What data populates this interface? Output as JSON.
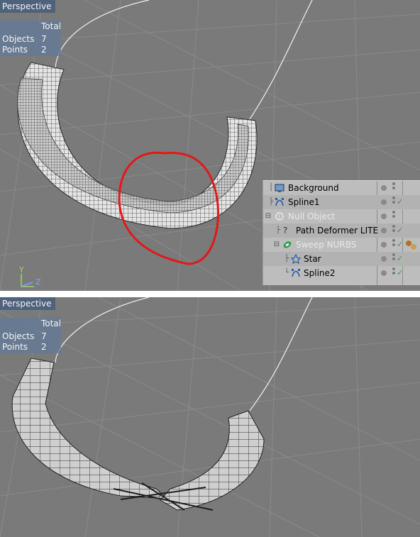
{
  "viewport_top": {
    "title": "Perspective",
    "hud": {
      "header": "Total",
      "rows": [
        {
          "label": "Objects",
          "value": "7"
        },
        {
          "label": "Points",
          "value": "2"
        }
      ]
    },
    "axis": {
      "y": "Y",
      "z": "Z"
    }
  },
  "viewport_bottom": {
    "title": "Perspective",
    "hud": {
      "header": "Total",
      "rows": [
        {
          "label": "Objects",
          "value": "7"
        },
        {
          "label": "Points",
          "value": "2"
        }
      ]
    }
  },
  "object_manager": {
    "items": [
      {
        "name": "Background",
        "icon": "background-icon",
        "enabled": true
      },
      {
        "name": "Spline1",
        "icon": "spline-icon",
        "enabled": true
      },
      {
        "name": "Null Object",
        "icon": "null-object-icon",
        "enabled": false
      },
      {
        "name": "Path Deformer LITE",
        "icon": "path-deformer-icon",
        "enabled": true
      },
      {
        "name": "Sweep NURBS",
        "icon": "sweep-nurbs-icon",
        "enabled": false
      },
      {
        "name": "Star",
        "icon": "star-icon",
        "enabled": true
      },
      {
        "name": "Spline2",
        "icon": "spline-icon",
        "enabled": true
      }
    ]
  },
  "colors": {
    "viewport_bg": "#7a7a7a",
    "hud_bg": "#627a98",
    "annotation": "#e0191a",
    "panel_bg": "#bdbdbd"
  }
}
